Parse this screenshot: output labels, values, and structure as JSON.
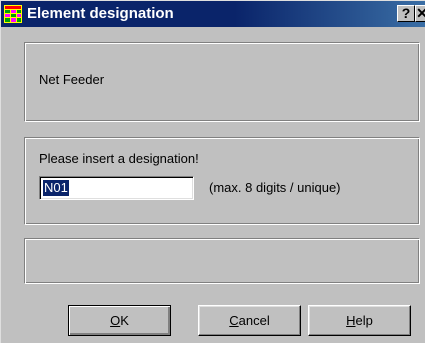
{
  "window": {
    "title": "Element designation",
    "help_glyph": "?",
    "close_glyph": "✕",
    "icon": "app-grid-icon"
  },
  "element": {
    "type_label": "Net Feeder"
  },
  "designation": {
    "prompt": "Please insert a designation!",
    "value": "N01",
    "hint": "(max. 8 digits / unique)"
  },
  "status": {
    "text": ""
  },
  "buttons": {
    "ok": {
      "mnemonic": "O",
      "rest": "K"
    },
    "cancel": {
      "mnemonic": "C",
      "rest": "ancel"
    },
    "help": {
      "mnemonic": "H",
      "rest": "elp"
    }
  },
  "colors": {
    "titlebar": "#0a246a",
    "face": "#c0c0c0",
    "selection": "#0a246a"
  }
}
